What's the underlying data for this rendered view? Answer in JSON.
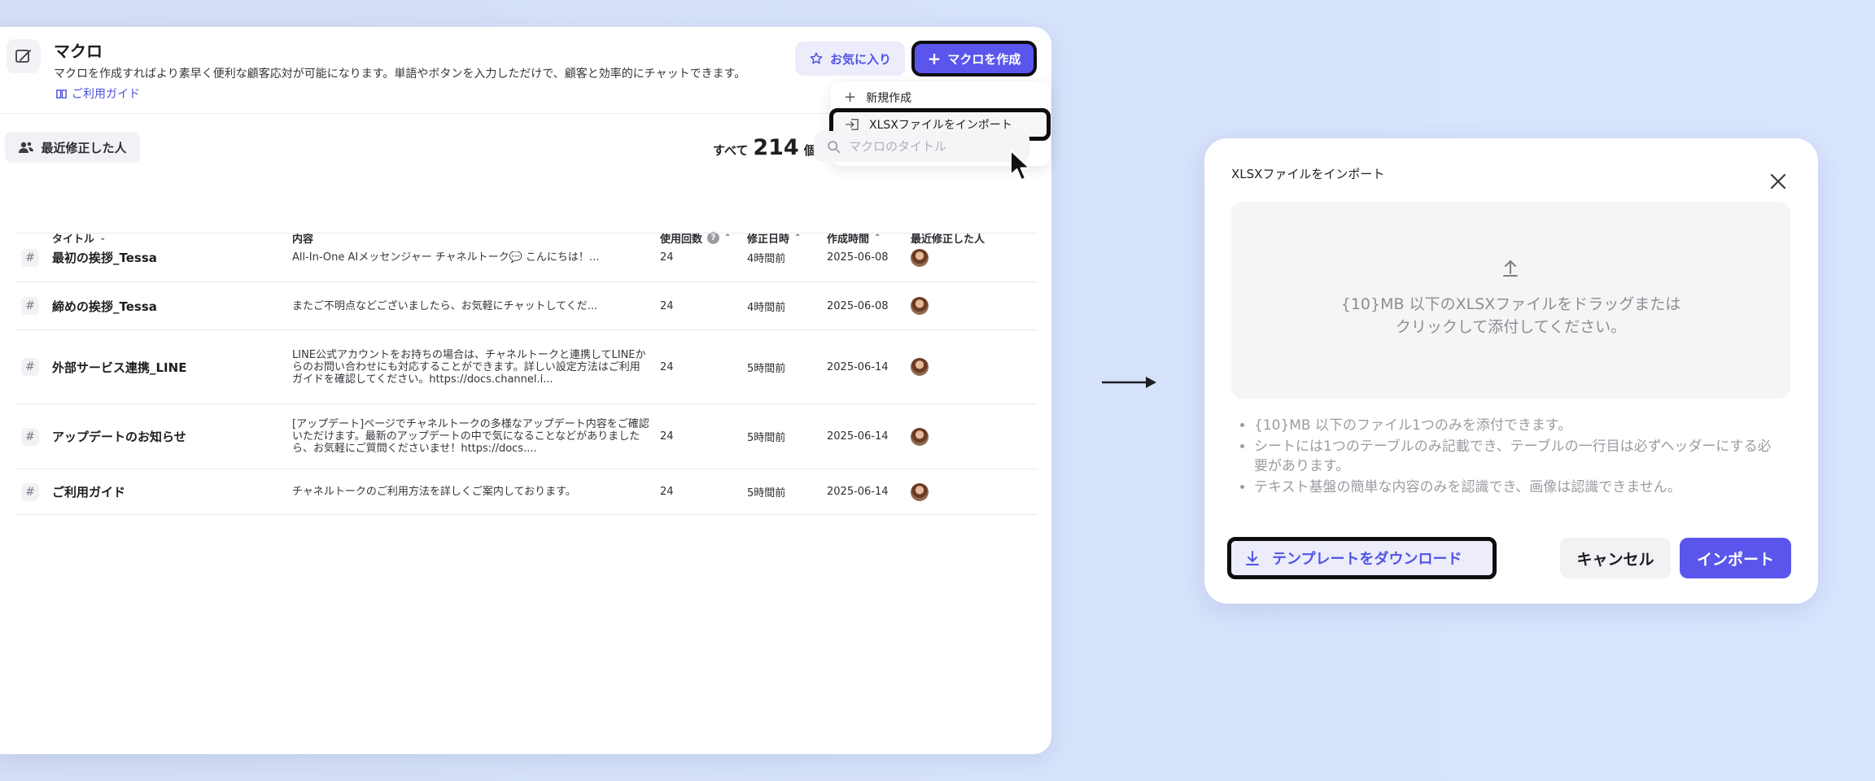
{
  "header": {
    "title": "マクロ",
    "description": "マクロを作成すればより素早く便利な顧客応対が可能になります。単語やボタンを入力しただけで、顧客と効率的にチャットできます。",
    "guide_link": "ご利用ガイド",
    "favorite_label": "お気に入り",
    "create_label": "マクロを作成"
  },
  "create_menu": {
    "items": [
      "新規作成",
      "XLSXファイルをインポート"
    ]
  },
  "toolbar": {
    "recent_filter_label": "最近修正した人",
    "count_prefix": "すべて",
    "count_value": "214",
    "count_suffix": "個",
    "search_placeholder": "マクロのタイトル"
  },
  "table": {
    "columns": {
      "title": "タイトル",
      "content": "内容",
      "uses": "使用回数",
      "modified": "修正日時",
      "created": "作成時間",
      "modifier": "最近修正した人"
    },
    "rows": [
      {
        "title": "最初の挨拶_Tessa",
        "content": "All-In-One AIメッセンジャー チャネルトーク💬 こんにちは！...",
        "uses": "24",
        "modified": "4時間前",
        "created": "2025-06-08"
      },
      {
        "title": "締めの挨拶_Tessa",
        "content": "またご不明点などございましたら、お気軽にチャットしてくだ...",
        "uses": "24",
        "modified": "4時間前",
        "created": "2025-06-08"
      },
      {
        "title": "外部サービス連携_LINE",
        "content": "LINE公式アカウントをお持ちの場合は、チャネルトークと連携してLINEからのお問い合わせにも対応することができます。詳しい設定方法はご利用ガイドを確認してください。https://docs.channel.i...",
        "uses": "24",
        "modified": "5時間前",
        "created": "2025-06-14"
      },
      {
        "title": "アップデートのお知らせ",
        "content": "[アップデート]ページでチャネルトークの多様なアップデート内容をご確認いただけます。最新のアップデートの中で気になることなどがありましたら、お気軽にご質問くださいませ！https://docs....",
        "uses": "24",
        "modified": "5時間前",
        "created": "2025-06-14"
      },
      {
        "title": "ご利用ガイド",
        "content": "チャネルトークのご利用方法を詳しくご案内しております。",
        "uses": "24",
        "modified": "5時間前",
        "created": "2025-06-14"
      }
    ]
  },
  "dialog": {
    "title": "XLSXファイルをインポート",
    "dropzone_text": "{10}MB 以下のXLSXファイルをドラッグまたは\nクリックして添付してください。",
    "notes": [
      "{10}MB 以下のファイル1つのみを添付できます。",
      "シートには1つのテーブルのみ記載でき、テーブルの一行目は必ずヘッダーにする必要があります。",
      "テキスト基盤の簡単な内容のみを認識でき、画像は認識できません。"
    ],
    "download_label": "テンプレートをダウンロード",
    "cancel_label": "キャンセル",
    "import_label": "インポート"
  },
  "colors": {
    "accent": "#5a56ec",
    "accent_soft": "#ececfb",
    "background": "#d6e2fa",
    "highlight_border": "#0d0d0f"
  },
  "icons": {
    "header": "macro-icon",
    "guide": "book-icon",
    "favorite": "star-icon",
    "create": "plus-icon",
    "import": "import-icon",
    "recent": "users-icon",
    "search": "search-icon",
    "upload": "upload-icon",
    "download": "download-icon",
    "close": "close-icon",
    "flow": "right-arrow-icon"
  }
}
